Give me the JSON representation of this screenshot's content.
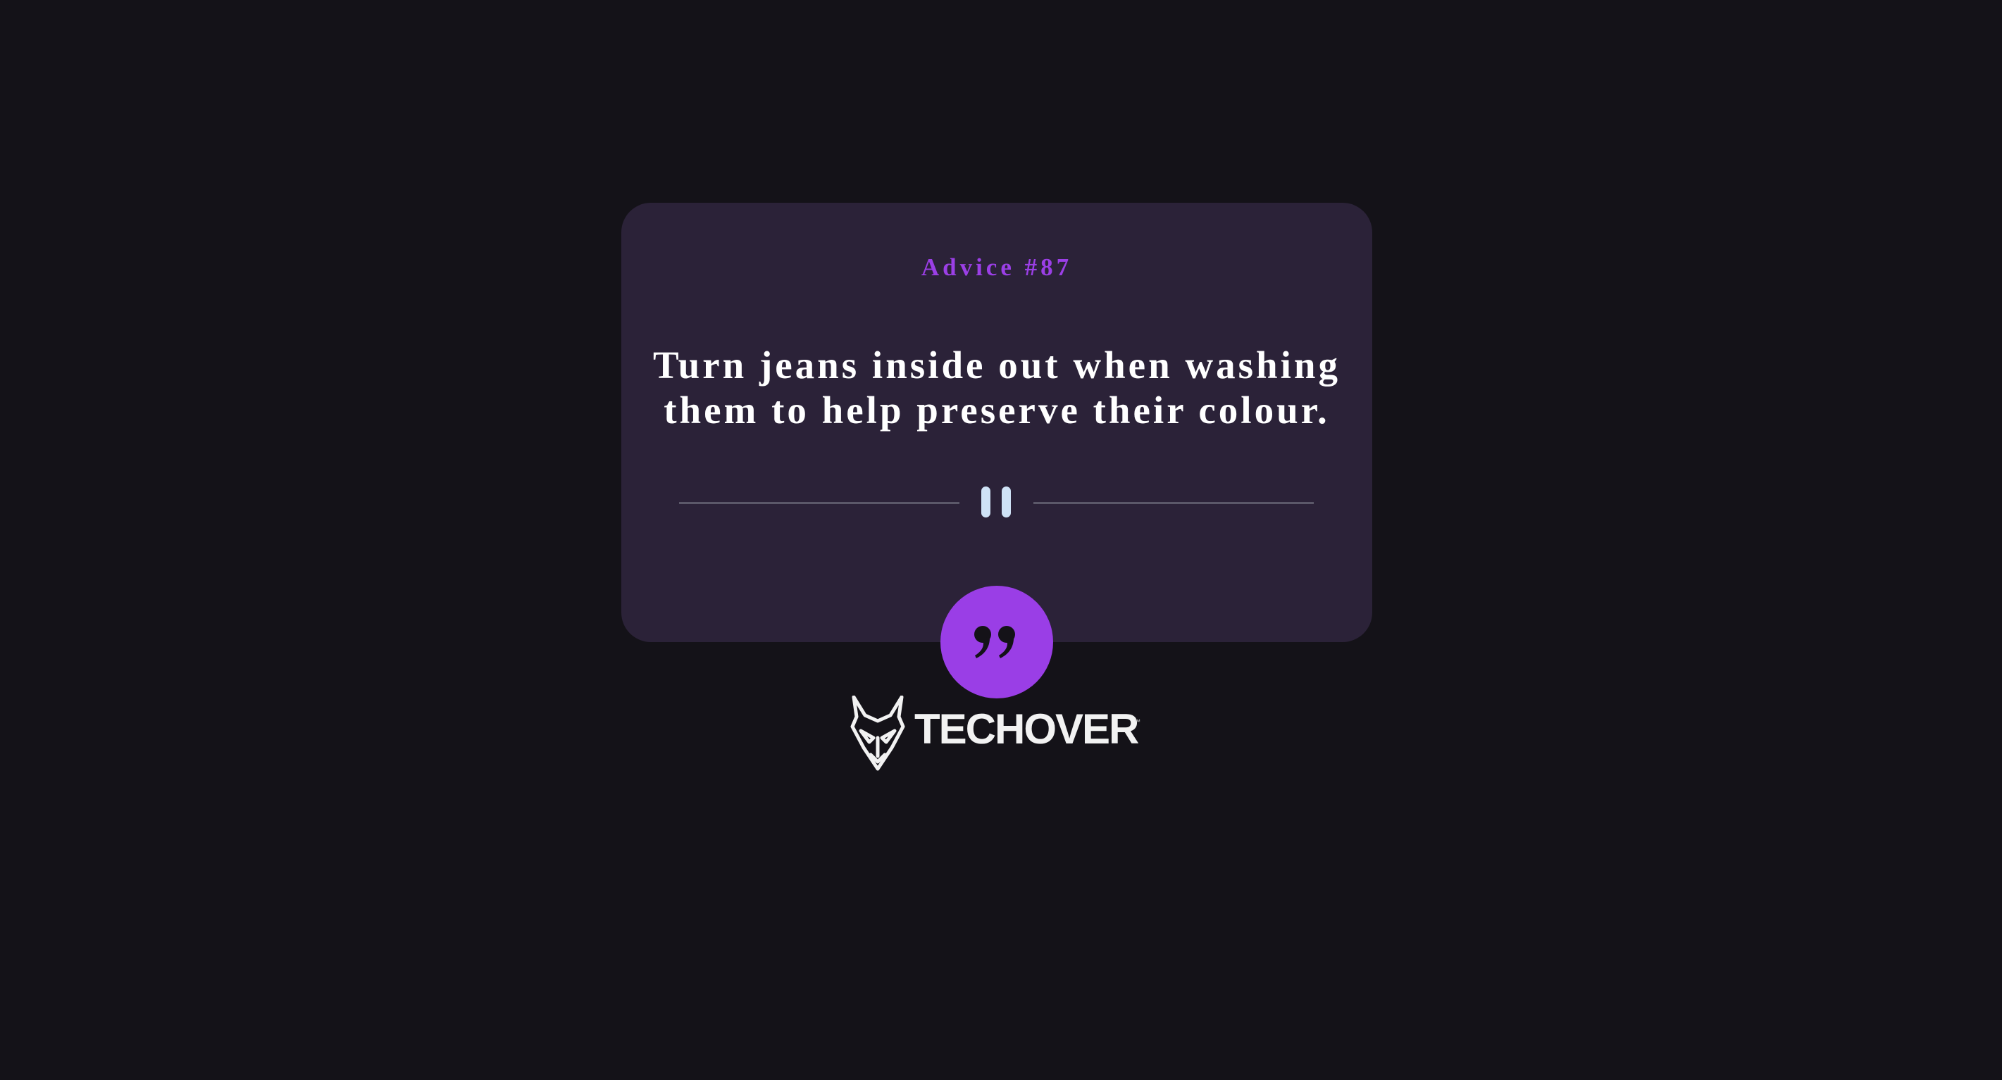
{
  "advice": {
    "title": "Advice #87",
    "text": "Turn jeans inside out when washing them to help preserve their colour."
  },
  "divider": {
    "icon": "pause-icon"
  },
  "quote_button": {
    "icon": "quote-icon"
  },
  "brand": {
    "name": "TECHOVER",
    "trademark": "™"
  },
  "colors": {
    "background": "#141218",
    "card": "#2b2238",
    "accent": "#9a3ee6",
    "text": "#ffffff"
  }
}
